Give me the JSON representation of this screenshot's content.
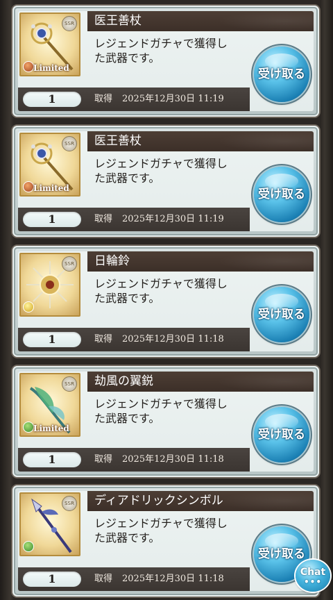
{
  "receive_label": "受け取る",
  "acquired_label": "取得",
  "chat_label": "Chat",
  "chat_dots": "•••",
  "items": [
    {
      "name": "医王善杖",
      "desc_line1": "レジェンドガチャで獲得し",
      "desc_line2": "た武器です。",
      "quantity": "1",
      "date": "2025年12月30日 11:19",
      "rarity": "SSR",
      "element": "fire",
      "limited": "Limited",
      "weapon_icon": "staff-icon"
    },
    {
      "name": "医王善杖",
      "desc_line1": "レジェンドガチャで獲得し",
      "desc_line2": "た武器です。",
      "quantity": "1",
      "date": "2025年12月30日 11:19",
      "rarity": "SSR",
      "element": "fire",
      "limited": "Limited",
      "weapon_icon": "staff-icon"
    },
    {
      "name": "日輪鈴",
      "desc_line1": "レジェンドガチャで獲得し",
      "desc_line2": "た武器です。",
      "quantity": "1",
      "date": "2025年12月30日 11:18",
      "rarity": "SSR",
      "element": "light",
      "limited": "",
      "weapon_icon": "sun-bell-icon"
    },
    {
      "name": "劫風の翼鋭",
      "desc_line1": "レジェンドガチャで獲得し",
      "desc_line2": "た武器です。",
      "quantity": "1",
      "date": "2025年12月30日 11:18",
      "rarity": "SSR",
      "element": "wind",
      "limited": "Limited",
      "weapon_icon": "wing-blade-icon"
    },
    {
      "name": "ディアドリックシンボル",
      "desc_line1": "レジェンドガチャで獲得し",
      "desc_line2": "た武器です。",
      "quantity": "1",
      "date": "2025年12月30日 11:18",
      "rarity": "SSR",
      "element": "wind",
      "limited": "",
      "weapon_icon": "spear-icon"
    }
  ]
}
